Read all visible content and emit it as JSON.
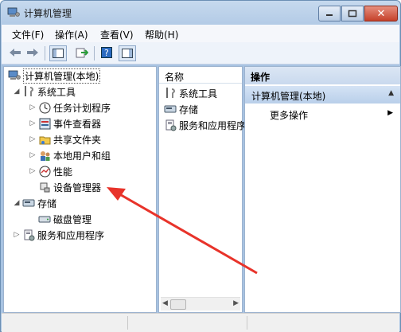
{
  "window": {
    "title": "计算机管理"
  },
  "menu": [
    "文件(F)",
    "操作(A)",
    "查看(V)",
    "帮助(H)"
  ],
  "tree": {
    "root": "计算机管理(本地)",
    "system_tools": "系统工具",
    "task_scheduler": "任务计划程序",
    "event_viewer": "事件查看器",
    "shared_folders": "共享文件夹",
    "local_users": "本地用户和组",
    "performance": "性能",
    "device_manager": "设备管理器",
    "storage": "存储",
    "disk_management": "磁盘管理",
    "services_apps": "服务和应用程序"
  },
  "middle": {
    "column_name": "名称",
    "items": [
      "系统工具",
      "存储",
      "服务和应用程序"
    ]
  },
  "actions": {
    "header": "操作",
    "section": "计算机管理(本地)",
    "more": "更多操作"
  },
  "colors": {
    "accent": "#e8332a",
    "selection": "#3399ff"
  }
}
